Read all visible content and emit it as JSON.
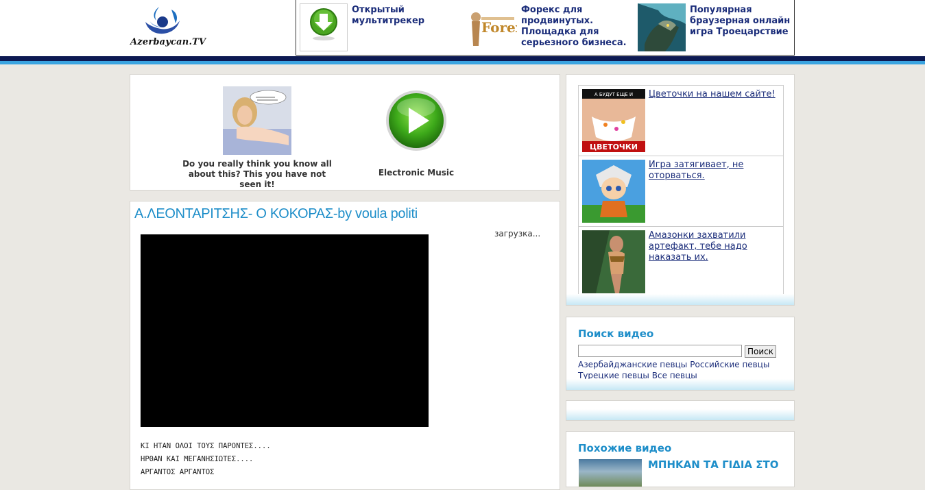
{
  "logo": {
    "text": "Azerbaycan.TV"
  },
  "top_ads": [
    {
      "text": "Открытый мультитрекер",
      "icon": "download-arrow-icon"
    },
    {
      "text": "Форекс для продвинутых. Площадка для серьезного бизнеса.",
      "logo_text": "Forex"
    },
    {
      "text": "Популярная браузерная онлайн игра Троецарствие"
    }
  ],
  "promo": {
    "item1_caption": "Do you really think you know all about this? This you have not seen it!",
    "item2_caption": "Electronic Music"
  },
  "video": {
    "title": "Α.ΛΕΟΝΤΑΡΙΤΣΗΣ- Ο ΚΟΚΟΡΑΣ-by voula politi",
    "loading": "загрузка...",
    "lyrics": [
      "ΚΙ ΗΤΑΝ ΟΛΟΙ ΤΟΥΣ ΠΑΡΟΝΤΕΣ....",
      "ΗΡΘΑΝ ΚΑΙ ΜΕΓΑΝΗΣΙΩΤΕΣ....",
      "ΑΡΓΑΝΤΟΣ ΑΡΓΑΝΤΟΣ"
    ]
  },
  "side_ads": [
    {
      "text": "Цветочки на нашем сайте!",
      "banner_top": "А БУДУТ ЕЩЕ И",
      "banner_bottom": "ЦВЕТОЧКИ"
    },
    {
      "text": "Игра затягивает, не оторваться."
    },
    {
      "text": "Амазонки захватили артефакт, тебе надо наказать их."
    }
  ],
  "search": {
    "heading": "Поиск видео",
    "input_value": "",
    "button_label": "Поиск",
    "links": [
      "Азербайджанские певцы",
      "Российские певцы",
      "Турецкие певцы",
      "Все певцы"
    ]
  },
  "similar": {
    "heading": "Похожие видео",
    "first_title": "ΜΠΗΚΑΝ ΤΑ ΓΙΔΙΑ ΣΤΟ"
  },
  "colors": {
    "accent": "#1e8ec9",
    "link": "#1b2d7a",
    "header_dark": "#0d1a52",
    "header_light": "#3ba4e0"
  }
}
